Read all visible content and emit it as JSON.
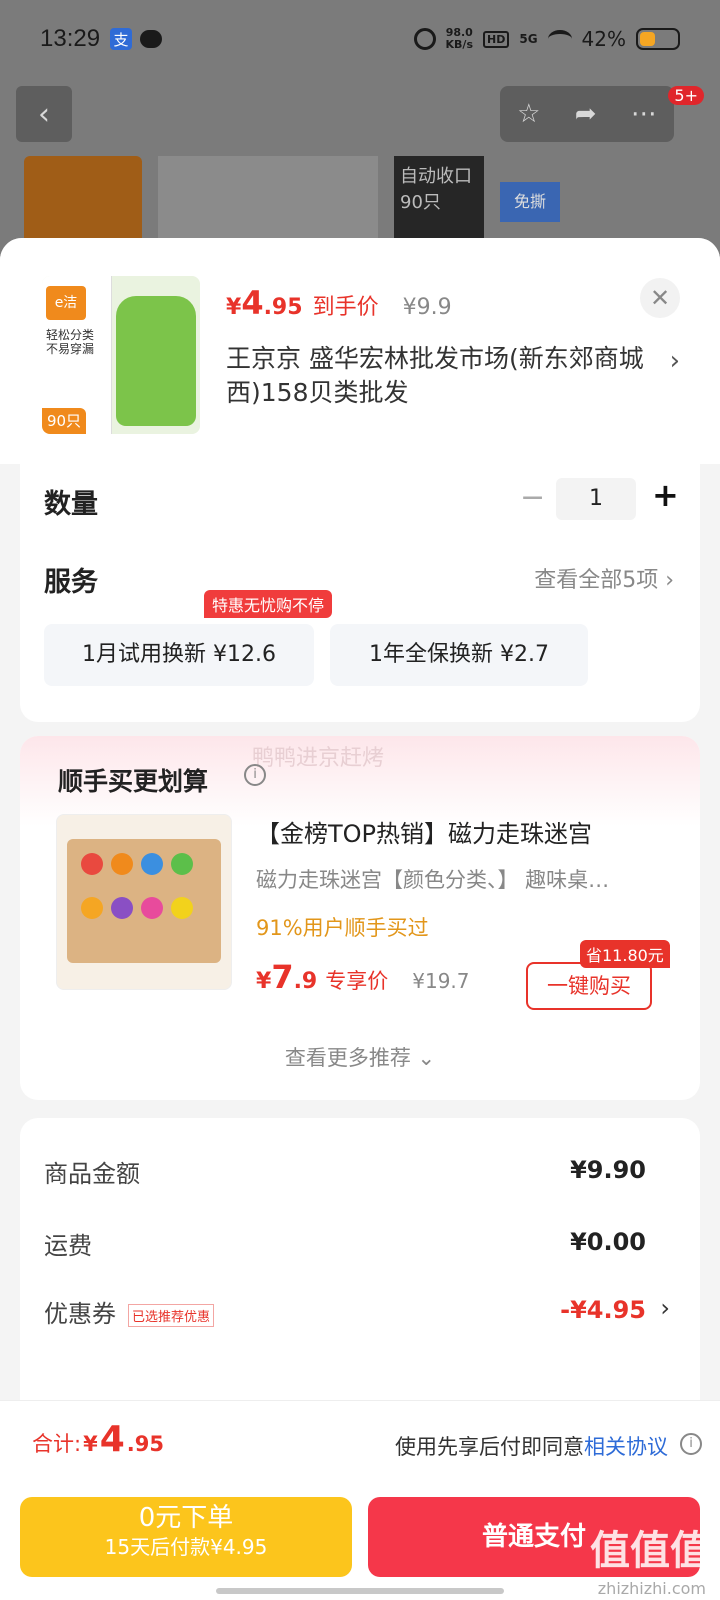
{
  "status_bar": {
    "time": "13:29",
    "app_badge": "支",
    "net_speed": "98.0\nKB/s",
    "hd": "HD",
    "signal": "5G",
    "battery": "42%",
    "battery_level": 0.42
  },
  "background_page": {
    "share_badge": "5+",
    "strip_text_dark": "自动收口 90只",
    "strip_tag": "免撕"
  },
  "product": {
    "thumb_logo": "e洁",
    "thumb_text": "轻松分类\n不易穿漏",
    "thumb_count": "90只",
    "price_symbol": "¥",
    "price_int": "4",
    "price_dec": ".95",
    "price_label": "到手价",
    "original_price": "¥9.9",
    "shop": "王京京  盛华宏林批发市场(新东郊商城西)158贝类批发"
  },
  "quantity": {
    "label": "数量",
    "value": "1",
    "minus": "−",
    "plus": "+"
  },
  "service": {
    "label": "服务",
    "view_all": "查看全部5项 ›",
    "badge": "特惠无忧购不停",
    "options": [
      {
        "label": "1月试用换新  ¥12.6"
      },
      {
        "label": "1年全保换新  ¥2.7"
      }
    ]
  },
  "recommend": {
    "watermark": "鸭鸭进京赶烤",
    "title": "顺手买更划算",
    "item_title": "【金榜TOP热销】磁力走珠迷宫",
    "item_sub": "磁力走珠迷宫【颜色分类、】 趣味桌…",
    "social_proof": "91%用户顺手买过",
    "price_symbol": "¥",
    "price_int": "7",
    "price_dec": ".9",
    "price_label": "专享价",
    "original_price": "¥19.7",
    "save_badge": "省11.80元",
    "buy_button": "一键购买",
    "more": "查看更多推荐 ⌄"
  },
  "summary": {
    "rows": [
      {
        "label": "商品金额",
        "value": "¥9.90"
      },
      {
        "label": "运费",
        "value": "¥0.00"
      },
      {
        "label": "优惠券",
        "tag": "已选推荐优惠",
        "value": "-¥4.95"
      }
    ]
  },
  "bottom": {
    "total_label": "合计:",
    "total_symbol": "¥",
    "total_int": "4",
    "total_dec": ".95",
    "agree_text": "使用先享后付即同意",
    "agree_link": "相关协议",
    "later_main": "0元下单",
    "later_sub": "15天后付款¥4.95",
    "pay_button": "普通支付",
    "watermark": "值值值",
    "watermark_sub": "zhizhizhi.com"
  },
  "colors": {
    "accent_red": "#e8332a",
    "accent_yellow": "#fcc51c",
    "pay_red": "#f5374a",
    "link_blue": "#2e6bd7"
  }
}
